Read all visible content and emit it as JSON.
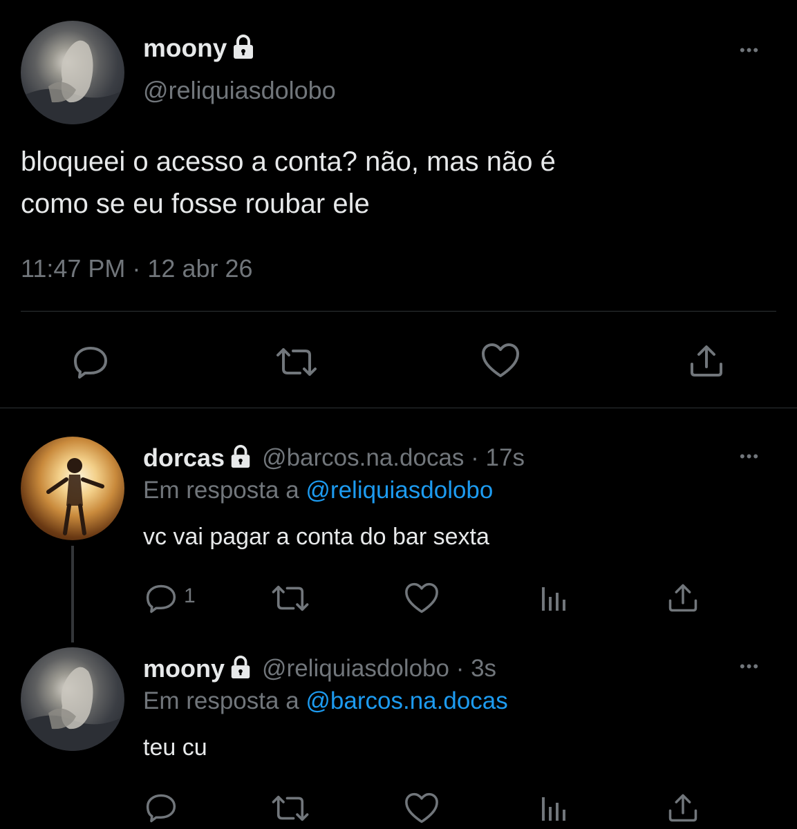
{
  "main_tweet": {
    "display_name": "moony",
    "handle": "@reliquiasdolobo",
    "text_line1": "bloqueei o acesso a conta? não, mas não é",
    "text_line2": "como se eu fosse roubar ele",
    "timestamp": "11:47 PM · 12 abr 26",
    "more_label": "•••"
  },
  "replies": [
    {
      "display_name": "dorcas",
      "handle_time": "@barcos.na.docas · 17s",
      "replying_prefix": "Em resposta a",
      "replying_to": "@reliquiasdolobo",
      "text": "vc vai pagar a conta do bar sexta",
      "reply_count": "1",
      "more_label": "•••"
    },
    {
      "display_name": "moony",
      "handle_time": "@reliquiasdolobo · 3s",
      "replying_prefix": "Em resposta a",
      "replying_to": "@barcos.na.docas",
      "text": "teu cu",
      "more_label": "•••"
    }
  ],
  "icons": {
    "reply": "reply-icon",
    "retweet": "retweet-icon",
    "like": "heart-icon",
    "views": "views-icon",
    "share": "share-icon",
    "lock": "lock-icon",
    "more": "more-icon"
  },
  "colors": {
    "background": "#000000",
    "text": "#e7e9ea",
    "muted": "#71767b",
    "link": "#1d9bf0",
    "divider": "#2f3336"
  }
}
